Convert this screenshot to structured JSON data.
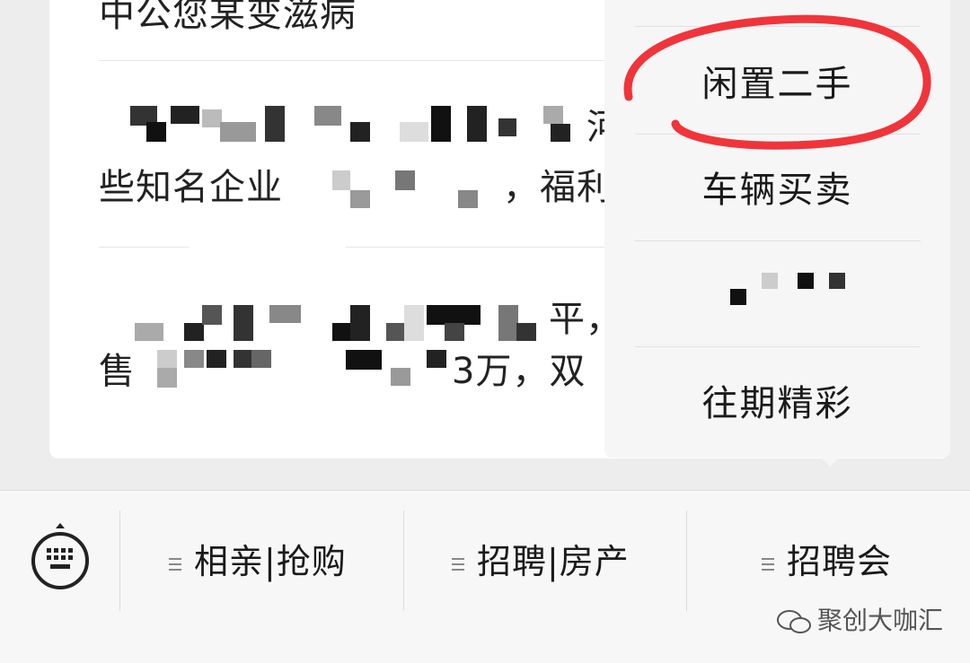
{
  "message_list": {
    "row1_text": "中公您某变滋病",
    "row2_line2_start": "些知名企业",
    "row2_line2_end": "，福利好",
    "row2_line1_end": "河",
    "row3_line1_end": "平，",
    "row3_line2_start": "售",
    "row3_line2_end": "3万，双"
  },
  "popup_menu": {
    "items": [
      "闲置二手",
      "车辆买卖",
      "往期精彩"
    ]
  },
  "annotation": {
    "circle_color": "#f0343a"
  },
  "bottom_menu": {
    "buttons": [
      "相亲|抢购",
      "招聘|房产",
      "招聘会"
    ]
  },
  "watermark": {
    "text": "聚创大咖汇"
  }
}
